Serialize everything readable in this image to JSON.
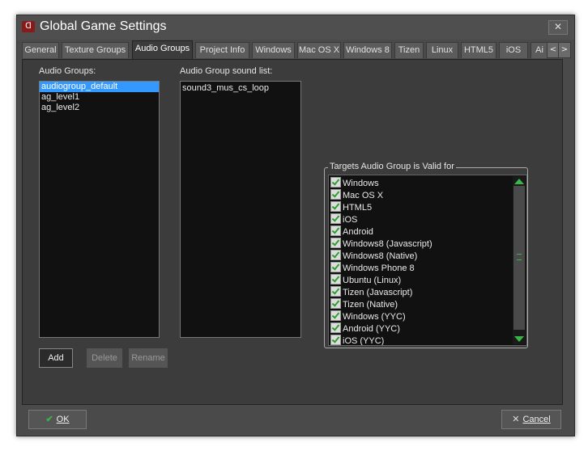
{
  "window": {
    "title": "Global Game Settings",
    "close": "✕"
  },
  "tabs": [
    {
      "label": "General"
    },
    {
      "label": "Texture Groups"
    },
    {
      "label": "Audio Groups"
    },
    {
      "label": "Project Info"
    },
    {
      "label": "Windows"
    },
    {
      "label": "Mac OS X"
    },
    {
      "label": "Windows 8"
    },
    {
      "label": "Tizen"
    },
    {
      "label": "Linux"
    },
    {
      "label": "HTML5"
    },
    {
      "label": "iOS"
    },
    {
      "label": "Ai"
    }
  ],
  "tab_arrows": {
    "left": "<",
    "right": ">"
  },
  "audio_groups": {
    "label": "Audio Groups:",
    "items": [
      "audiogroup_default",
      "ag_level1",
      "ag_level2"
    ],
    "selected": "audiogroup_default"
  },
  "sound_list": {
    "label": "Audio Group sound list:",
    "items": [
      "sound3_mus_cs_loop"
    ]
  },
  "buttons": {
    "add": "Add",
    "delete": "Delete",
    "rename": "Rename"
  },
  "targets": {
    "title": "Targets Audio Group is Valid for",
    "items": [
      "Windows",
      "Mac OS X",
      "HTML5",
      "iOS",
      "Android",
      "Windows8 (Javascript)",
      "Windows8 (Native)",
      "Windows Phone 8",
      "Ubuntu (Linux)",
      "Tizen (Javascript)",
      "Tizen (Native)",
      "Windows (YYC)",
      "Android (YYC)",
      "iOS (YYC)"
    ]
  },
  "footer": {
    "ok": "OK",
    "cancel": "Cancel"
  },
  "colors": {
    "accent": "#39b54a",
    "selection": "#3399ff",
    "window_bg": "#4a4a4a"
  }
}
